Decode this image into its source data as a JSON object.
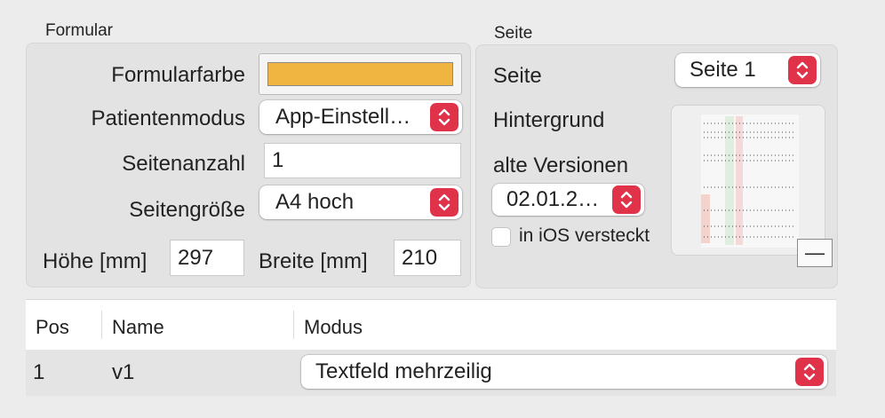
{
  "formular": {
    "title": "Formular",
    "color_label": "Formularfarbe",
    "color_value": "#f0b441",
    "patient_mode_label": "Patientenmodus",
    "patient_mode_value": "App-Einstell…",
    "page_count_label": "Seitenanzahl",
    "page_count_value": "1",
    "page_size_label": "Seitengröße",
    "page_size_value": "A4 hoch",
    "height_label": "Höhe [mm]",
    "height_value": "297",
    "width_label": "Breite [mm]",
    "width_value": "210"
  },
  "seite": {
    "title": "Seite",
    "page_label": "Seite",
    "page_value": "Seite 1",
    "background_label": "Hintergrund",
    "old_versions_label": "alte Versionen",
    "old_versions_value": "02.01.2…",
    "ios_hidden_label": "in iOS versteckt",
    "ios_hidden_checked": false,
    "remove_button_label": "—"
  },
  "table": {
    "headers": [
      "Pos",
      "Name",
      "Modus"
    ],
    "rows": [
      {
        "pos": "1",
        "name": "v1",
        "mode": "Textfeld mehrzeilig"
      }
    ]
  },
  "colors": {
    "accent_stepper": "#e0334a",
    "group_background": "#e3e3e3",
    "window_background": "#ececec"
  }
}
